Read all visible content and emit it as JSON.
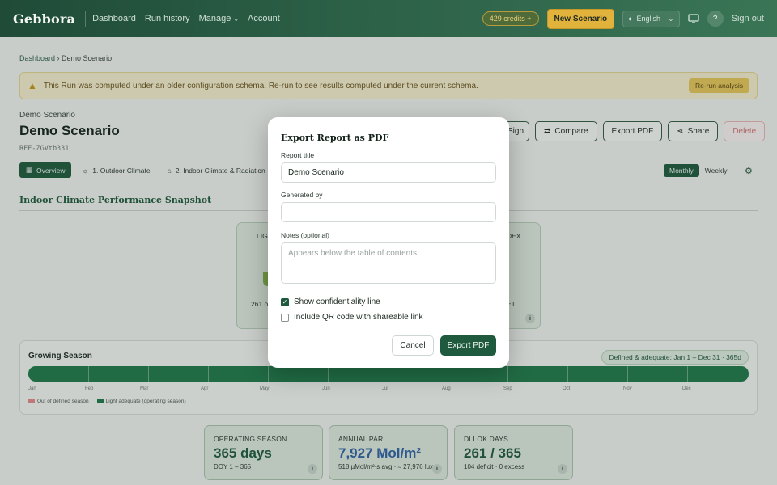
{
  "nav": {
    "logo": "Gebbora",
    "links": [
      "Dashboard",
      "Run history",
      "Manage",
      "Account"
    ],
    "credits": "429 credits",
    "new_scenario": "New Scenario",
    "language": "English",
    "help": "?",
    "sign_out": "Sign out"
  },
  "breadcrumb": {
    "home": "Dashboard",
    "current": "Demo Scenario"
  },
  "warning": {
    "text": "This Run was computed under an older configuration schema. Re-run to see results computed under the current schema.",
    "button": "Re-run analysis"
  },
  "project": {
    "label": "Demo Scenario",
    "title": "Demo Scenario",
    "ref": "REF-ZGVtb331"
  },
  "actions": {
    "sign": "Sign",
    "compare": "Compare",
    "export_pdf": "Export PDF",
    "share": "Share",
    "delete": "Delete"
  },
  "tabs": [
    "Overview",
    "1. Outdoor Climate",
    "2. Indoor Climate & Radiation"
  ],
  "period": {
    "monthly": "Monthly",
    "weekly": "Weekly"
  },
  "snapshot": {
    "title": "Indoor Climate Performance Snapshot",
    "card1_label": "LIG",
    "card1_value": "261 o",
    "card2_label": "DEX",
    "card2_value": "ET"
  },
  "growing": {
    "title": "Growing Season",
    "badge": "Defined & adequate: Jan 1 – Dec 31 · 365d",
    "months": [
      "Jan",
      "Feb",
      "Mar",
      "Apr",
      "May",
      "Jun",
      "Jul",
      "Aug",
      "Sep",
      "Oct",
      "Nov",
      "Dec"
    ],
    "legend_out": "Out of defined season",
    "legend_in": "Light adequate (operating season)"
  },
  "stats": [
    {
      "label": "OPERATING SEASON",
      "value": "365 days",
      "sub": "DOY 1 – 365",
      "color": "#1f5a3e"
    },
    {
      "label": "ANNUAL PAR",
      "value": "7,927 Mol/m²",
      "sub": "518 µMol/m²·s avg · ≈ 27,976 lux",
      "color": "#2f63a8"
    },
    {
      "label": "DLI OK DAYS",
      "value": "261 / 365",
      "sub": "104 deficit · 0 excess",
      "color": "#1f5a3e"
    }
  ],
  "modal": {
    "title": "Export Report as PDF",
    "report_title_label": "Report title",
    "report_title_value": "Demo Scenario",
    "generated_by_label": "Generated by",
    "generated_by_value": "",
    "notes_label": "Notes (optional)",
    "notes_placeholder": "Appears below the table of contents",
    "confidentiality_label": "Show confidentiality line",
    "confidentiality_checked": true,
    "qr_label": "Include QR code with shareable link",
    "qr_checked": false,
    "cancel": "Cancel",
    "export": "Export PDF"
  }
}
